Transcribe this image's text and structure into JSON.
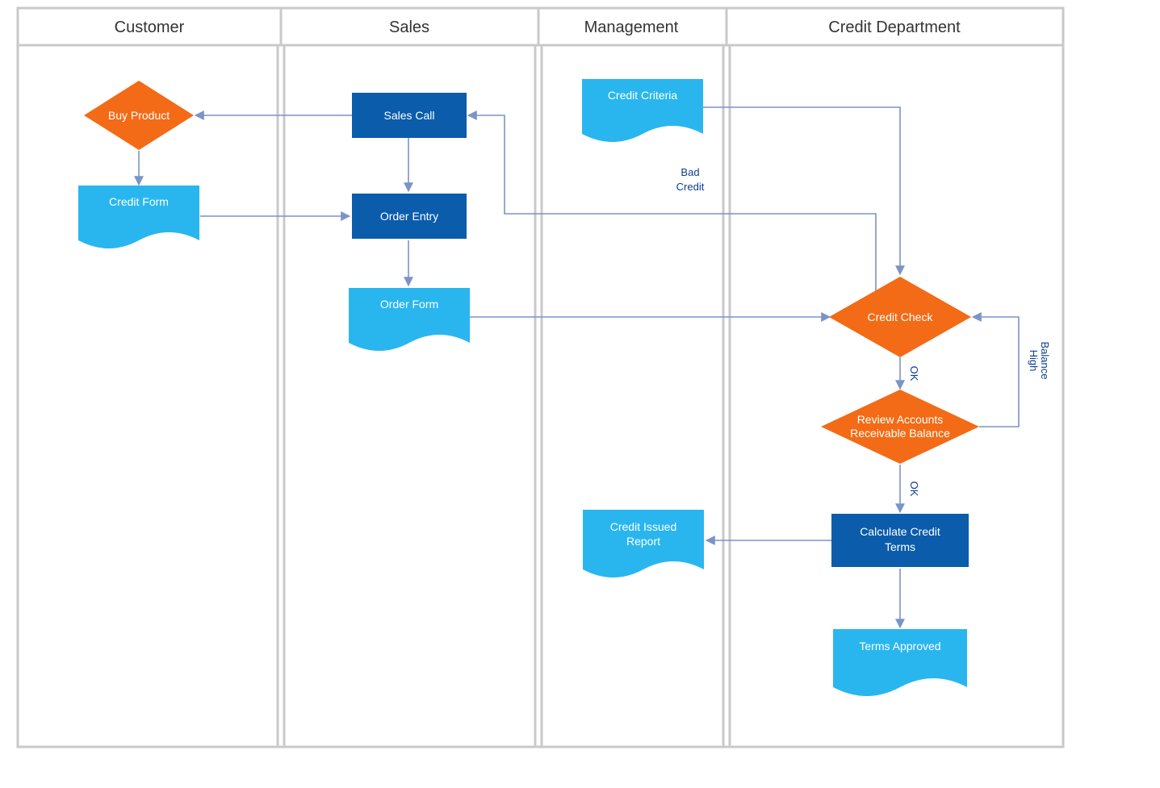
{
  "lanes": [
    {
      "id": "customer",
      "title": "Customer"
    },
    {
      "id": "sales",
      "title": "Sales"
    },
    {
      "id": "management",
      "title": "Management"
    },
    {
      "id": "credit",
      "title": "Credit Department"
    }
  ],
  "nodes": {
    "buy_product": {
      "label": "Buy Product",
      "lane": "customer",
      "type": "decision"
    },
    "credit_form": {
      "label": "Credit Form",
      "lane": "customer",
      "type": "document"
    },
    "sales_call": {
      "label": "Sales Call",
      "lane": "sales",
      "type": "process"
    },
    "order_entry": {
      "label": "Order Entry",
      "lane": "sales",
      "type": "process"
    },
    "order_form": {
      "label": "Order Form",
      "lane": "sales",
      "type": "document"
    },
    "credit_criteria": {
      "label": "Credit Criteria",
      "lane": "management",
      "type": "document"
    },
    "credit_issued": {
      "label1": "Credit Issued",
      "label2": "Report",
      "lane": "management",
      "type": "document"
    },
    "credit_check": {
      "label": "Credit Check",
      "lane": "credit",
      "type": "decision"
    },
    "review_ar": {
      "label1": "Review Accounts",
      "label2": "Receivable Balance",
      "lane": "credit",
      "type": "decision"
    },
    "calc_terms": {
      "label1": "Calculate Credit",
      "label2": "Terms",
      "lane": "credit",
      "type": "process"
    },
    "terms_approved": {
      "label": "Terms Approved",
      "lane": "credit",
      "type": "document"
    }
  },
  "edgeLabels": {
    "bad_credit1": "Bad",
    "bad_credit2": "Credit",
    "ok1": "OK",
    "ok2": "OK",
    "high_bal1": "High",
    "high_bal2": "Balance"
  },
  "colors": {
    "laneBorder": "#c9c9c9",
    "process": "#0b5cab",
    "decision": "#f36b16",
    "document": "#29b6ef",
    "arrow": "#7a94c7"
  }
}
